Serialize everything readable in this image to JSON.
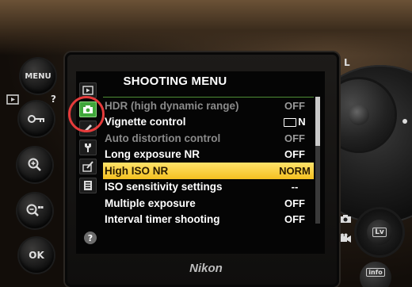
{
  "screen": {
    "title": "SHOOTING MENU",
    "menu_items": [
      {
        "label": "HDR (high dynamic range)",
        "value": "OFF",
        "state": "dim"
      },
      {
        "label": "Vignette control",
        "value": "N",
        "value_icon": "vignette-box-icon",
        "state": "normal"
      },
      {
        "label": "Auto distortion control",
        "value": "OFF",
        "state": "dim"
      },
      {
        "label": "Long exposure NR",
        "value": "OFF",
        "state": "normal"
      },
      {
        "label": "High ISO NR",
        "value": "NORM",
        "state": "selected"
      },
      {
        "label": "ISO sensitivity settings",
        "value": "--",
        "state": "normal"
      },
      {
        "label": "Multiple exposure",
        "value": "OFF",
        "state": "normal"
      },
      {
        "label": "Interval timer shooting",
        "value": "OFF",
        "state": "normal"
      }
    ],
    "tabs": [
      {
        "icon": "playback-icon"
      },
      {
        "icon": "camera-icon",
        "active": true
      },
      {
        "icon": "pencil-icon"
      },
      {
        "icon": "wrench-icon"
      },
      {
        "icon": "retouch-icon"
      },
      {
        "icon": "my-menu-icon"
      }
    ],
    "help_label": "?",
    "selection_color": "#f6c62a",
    "active_tab_color": "#3fa63a"
  },
  "camera": {
    "brand": "Nikon",
    "left_buttons": [
      {
        "label": "MENU"
      },
      {
        "icon": "key-icon"
      },
      {
        "icon": "zoom-in-icon"
      },
      {
        "icon": "zoom-out-icon"
      },
      {
        "label": "OK"
      }
    ],
    "top_right_label": "L",
    "lv_label": "Lv",
    "info_label": "info",
    "highlight_color": "#e53b3b"
  }
}
